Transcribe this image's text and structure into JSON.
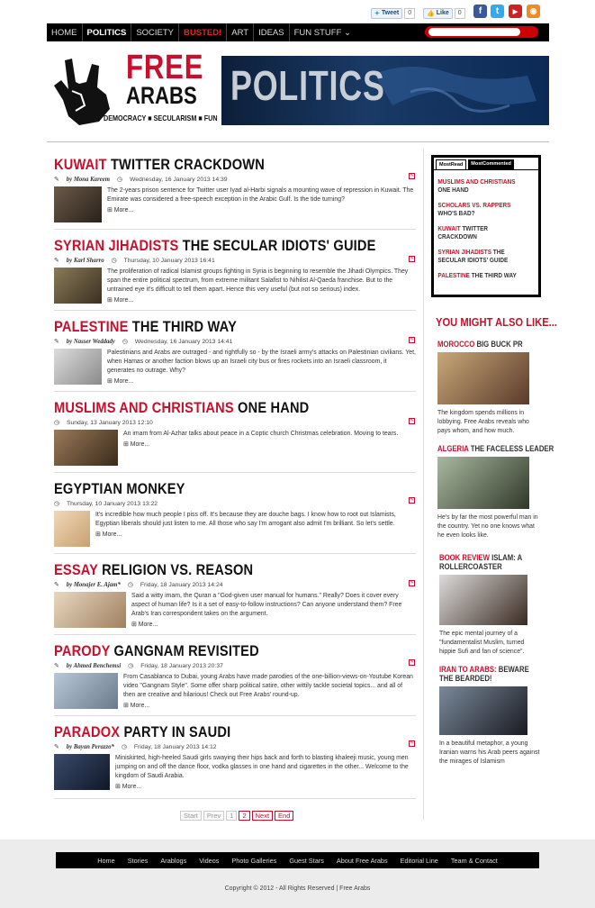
{
  "social": {
    "tweet_label": "Tweet",
    "tweet_count": "0",
    "like_label": "Like",
    "like_count": "0"
  },
  "nav": {
    "items": [
      "HOME",
      "POLITICS",
      "SOCIETY",
      "BUSTED!",
      "ART",
      "IDEAS",
      "FUN STUFF"
    ],
    "search_placeholder": ""
  },
  "logo": {
    "free": "FREE",
    "arabs": "ARABS",
    "tagline": "DEMOCRACY ■ SECULARISM ■ FUN"
  },
  "banner": {
    "title": "POLITICS"
  },
  "articles": [
    {
      "red": "KUWAIT",
      "black": "TWITTER CRACKDOWN",
      "author": "by Mona Kareem",
      "date": "Wednesday, 16 January 2013 14:39",
      "text": "The 2-years prison sentence for Twitter user Iyad al-Harbi signals a mounting wave of repression in Kuwait. The Emirate was considered a free-speech exception in the Arabic Gulf. Is the tide turning?",
      "more": "More..."
    },
    {
      "red": "SYRIAN JIHADISTS",
      "black": "THE SECULAR IDIOTS' GUIDE",
      "author": "by Karl Sharro",
      "date": "Thursday, 10 January 2013 16:41",
      "text": "The proliferation of radical Islamist groups fighting in Syria is beginning to resemble the Jihadi Olympics. They span the entire political spectrum, from extreme militant Salafist to Nihilist Al-Qaeda franchise. But to the untrained eye it's difficult to tell them apart. Hence this very useful (but not so serious) index.",
      "more": "More..."
    },
    {
      "red": "PALESTINE",
      "black": "THE THIRD WAY",
      "author": "by Nasser Weddady",
      "date": "Wednesday, 16 January 2013 14:41",
      "text": "Palestinians and Arabs are outraged - and rightfully so - by the Israeli army's attacks on Palestinian civilians. Yet, when Hamas or another faction blows up an Israeli city bus or fires rockets into an Israeli classroom, it generates no outrage. Why?",
      "more": "More..."
    },
    {
      "red": "MUSLIMS AND CHRISTIANS",
      "black": "ONE HAND",
      "author": "",
      "date": "Sunday, 13 January 2013 12:10",
      "text": "An imam from Al-Azhar talks about peace in a Coptic church Christmas celebration. Moving to tears.",
      "more": "More..."
    },
    {
      "red": "",
      "black": "EGYPTIAN MONKEY",
      "author": "",
      "date": "Thursday, 10 January 2013 13:22",
      "text": "It's incredible how much people I piss off. It's because they are douche bags. I know how to root out Islamists, Egyptian liberals should just listen to me. All those who say I'm arrogant also admit I'm brilliant. So let's settle.",
      "more": "More..."
    },
    {
      "red": "ESSAY",
      "black": "RELIGION VS. REASON",
      "author": "by Monajer E. Ajam*",
      "date": "Friday, 18 January 2013 14:24",
      "text": "Said a witty imam, the Quran a \"God-given user manual for humans.\" Really? Does it cover every aspect of human life? Is it a set of easy-to-follow instructions? Can anyone understand them? Free Arab's Iran correspondent takes on the argument.",
      "more": "More..."
    },
    {
      "red": "PARODY",
      "black": "GANGNAM REVISITED",
      "author": "by Ahmed Benchemsi",
      "date": "Friday, 18 January 2013 20:37",
      "text": "From Casablanca to Dubai, young Arabs have made parodies of the one-billion-views-on-Youtube Korean video \"Gangnam Style\". Some offer sharp political satire, other wittily tackle societal topics... and all of then are creative and hilarious! Check out Free Arabs' round-up.",
      "more": "More..."
    },
    {
      "red": "PARADOX",
      "black": "PARTY IN SAUDI",
      "author": "by Bayan Perazzo*",
      "date": "Friday, 18 January 2013 14:12",
      "text": "Miniskirted, high-heeled Saudi girls swaying their hips back and forth to blasting khaleeji music, young men jumping on and off the dance floor, vodka glasses in one hand and cigarettes in the other... Welcome to the kingdom of Saudi Arabia.",
      "more": "More..."
    }
  ],
  "sidebar": {
    "tab_read": "MostRead",
    "tab_commented": "MostCommented",
    "most_read": [
      {
        "red": "MUSLIMS AND CHRISTIANS",
        "black": "ONE HAND"
      },
      {
        "red": "SCHOLARS VS. RAPPERS",
        "black": "WHO'S BAD?"
      },
      {
        "red": "KUWAIT",
        "black": "TWITTER CRACKDOWN"
      },
      {
        "red": "SYRIAN JIHADISTS",
        "black": "THE SECULAR IDIOTS' GUIDE"
      },
      {
        "red": "PALESTINE",
        "black": "THE THIRD WAY"
      }
    ],
    "also_title": "YOU MIGHT ALSO LIKE...",
    "also": [
      {
        "red": "MOROCCO",
        "black": "BIG BUCK PR",
        "text": "The kingdom spends millions in lobbying. Free Arabs reveals who pays whom, and how much."
      },
      {
        "red": "ALGERIA",
        "black": "THE FACELESS LEADER",
        "text": "He's by far the most powerful man in the country. Yet no one knows what he even looks like."
      },
      {
        "red": "BOOK REVIEW",
        "black": "ISLAM: A ROLLERCOASTER",
        "text": "The epic mental journey of a \"fundamentalist Muslim, turned hippie Sufi and fan of science\"."
      },
      {
        "red": "IRAN TO ARABS:",
        "black": "BEWARE THE BEARDED!",
        "text": "In a beautiful metaphor, a young Iranian warns his Arab peers against the mirages of Islamism"
      }
    ]
  },
  "pager": [
    "Start",
    "Prev",
    "1",
    "2",
    "Next",
    "End"
  ],
  "footer": {
    "links": [
      "Home",
      "Stories",
      "Arablogs",
      "Videos",
      "Photo Galleries",
      "Guest Stars",
      "About Free Arabs",
      "Editorial Line",
      "Team & Contact"
    ],
    "copyright": "Copyright © 2012 - All Rights Reserved | Free Arabs"
  }
}
